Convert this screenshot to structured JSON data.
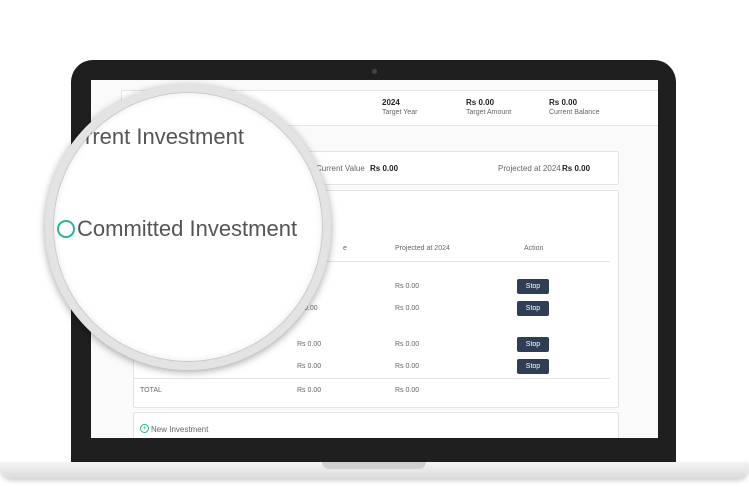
{
  "summary": {
    "target_year": {
      "value": "2024",
      "label": "Target Year"
    },
    "target_amount": {
      "value": "Rs 0.00",
      "label": "Target Amount"
    },
    "current_balance": {
      "value": "Rs 0.00",
      "label": "Current Balance"
    }
  },
  "current_investment": {
    "title_partial": "rrent Investment",
    "current_value_label": "Current Value",
    "current_value": "Rs 0.00",
    "projected_label": "Projected at 2024",
    "projected_value": "Rs 0.00"
  },
  "committed_investment": {
    "title": "Committed Investment",
    "columns": {
      "value_fragment": "e",
      "projected": "Projected at 2024",
      "action": "Action"
    },
    "rows": [
      {
        "value": "",
        "projected": "Rs 0.00",
        "action": "Stop"
      },
      {
        "value": "0.00",
        "projected": "Rs 0.00",
        "action": "Stop"
      },
      {
        "value": "Rs 0.00",
        "projected": "Rs 0.00",
        "action": "Stop"
      },
      {
        "value": "Rs 0.00",
        "projected": "Rs 0.00",
        "action": "Stop"
      }
    ],
    "total": {
      "label": "TOTAL",
      "value": "Rs 0.00",
      "projected": "Rs 0.00"
    }
  },
  "new_investment": {
    "label": "New Investment",
    "icon": "plus-circle-icon"
  },
  "colors": {
    "button_bg": "#2e3e55",
    "accent": "#2bb39a",
    "laptop_frame": "#1f1f1f"
  }
}
